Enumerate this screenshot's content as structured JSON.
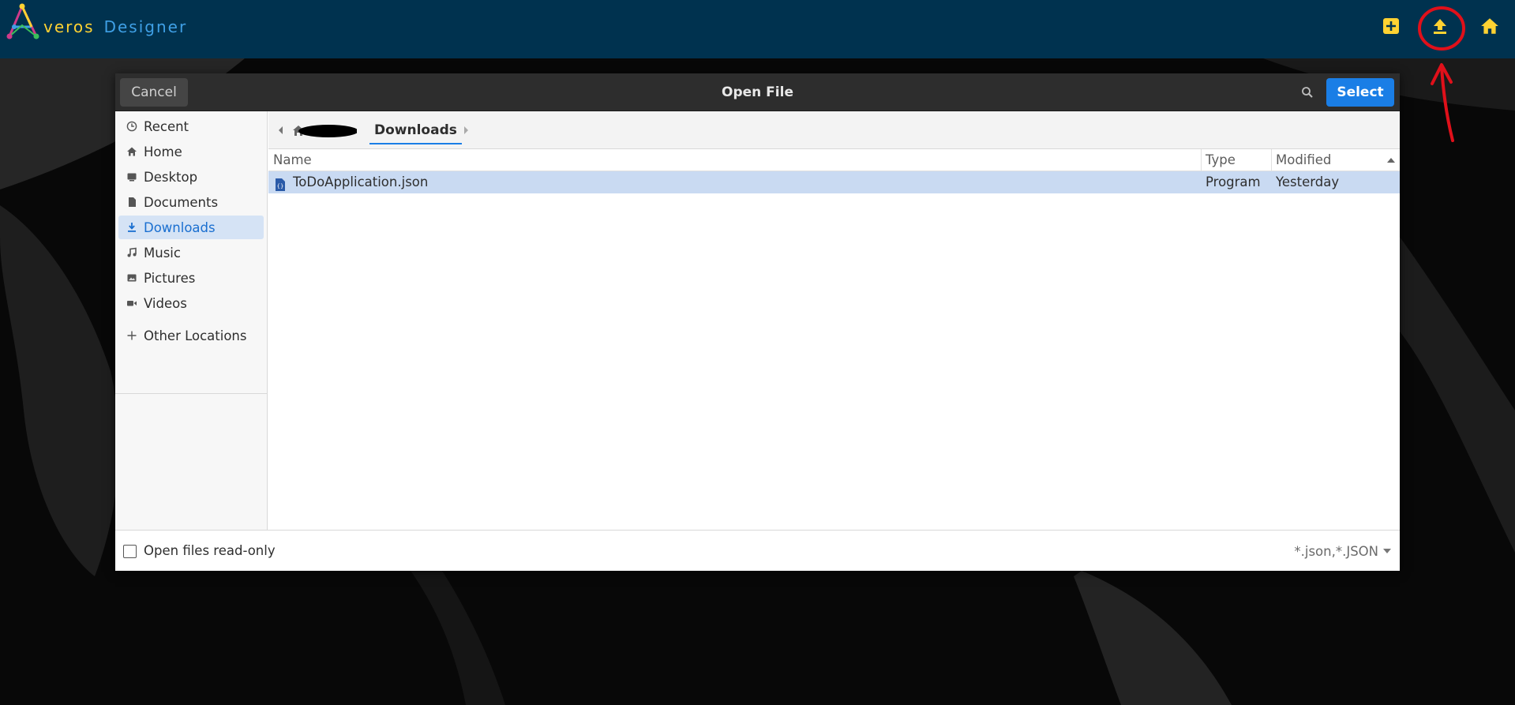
{
  "app": {
    "logo_text_1": "veros",
    "logo_text_2": "Designer",
    "bar_color": "#00324f",
    "accent_yellow": "#ffd232",
    "toolbar_icons": [
      "add-box-icon",
      "upload-icon",
      "home-icon"
    ]
  },
  "dialog": {
    "title": "Open File",
    "cancel_label": "Cancel",
    "select_label": "Select",
    "search_icon": "search-icon"
  },
  "sidebar": {
    "items": [
      {
        "label": "Recent",
        "icon": "clock-icon"
      },
      {
        "label": "Home",
        "icon": "home-icon"
      },
      {
        "label": "Desktop",
        "icon": "desktop-icon"
      },
      {
        "label": "Documents",
        "icon": "document-icon"
      },
      {
        "label": "Downloads",
        "icon": "download-icon",
        "active": true
      },
      {
        "label": "Music",
        "icon": "music-icon"
      },
      {
        "label": "Pictures",
        "icon": "picture-icon"
      },
      {
        "label": "Videos",
        "icon": "video-icon"
      }
    ],
    "other_locations": "Other Locations"
  },
  "pathbar": {
    "current": "Downloads"
  },
  "filelist": {
    "columns": {
      "name": "Name",
      "type": "Type",
      "modified": "Modified"
    },
    "rows": [
      {
        "name": "ToDoApplication.json",
        "type": "Program",
        "modified": "Yesterday"
      }
    ]
  },
  "footer": {
    "readonly_label": "Open files read-only",
    "filter": "*.json,*.JSON"
  }
}
